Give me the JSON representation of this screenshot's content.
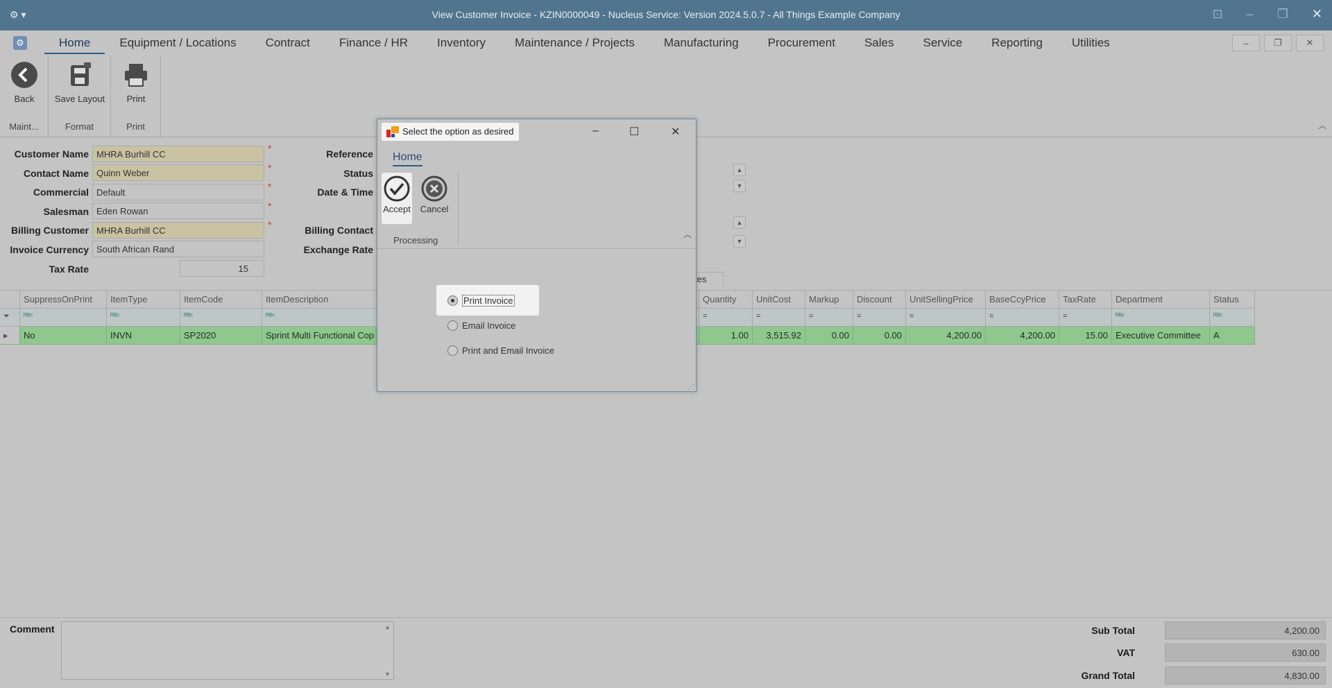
{
  "window": {
    "title": "View Customer Invoice - KZIN0000049 - Nucleus Service: Version 2024.5.0.7 - All Things Example Company"
  },
  "menu": {
    "tabs": [
      "Home",
      "Equipment / Locations",
      "Contract",
      "Finance / HR",
      "Inventory",
      "Maintenance / Projects",
      "Manufacturing",
      "Procurement",
      "Sales",
      "Service",
      "Reporting",
      "Utilities"
    ]
  },
  "ribbon": {
    "back_label": "Back",
    "save_layout_label": "Save Layout",
    "print_label": "Print",
    "group_maint": "Maint...",
    "group_format": "Format",
    "group_print": "Print"
  },
  "form": {
    "customer_name_label": "Customer Name",
    "customer_name_value": "MHRA Burhill CC",
    "contact_name_label": "Contact Name",
    "contact_name_value": "Quinn Weber",
    "commercial_label": "Commercial",
    "commercial_value": "Default",
    "salesman_label": "Salesman",
    "salesman_value": "Eden Rowan",
    "billing_customer_label": "Billing Customer",
    "billing_customer_value": "MHRA Burhill CC",
    "invoice_currency_label": "Invoice Currency",
    "invoice_currency_value": "South African Rand",
    "tax_rate_label": "Tax Rate",
    "tax_rate_value": "15",
    "reference_label": "Reference",
    "status_label": "Status",
    "date_time_label": "Date & Time",
    "billing_contact_label": "Billing Contact",
    "exchange_rate_label": "Exchange Rate",
    "required_mark": "*"
  },
  "grid": {
    "tab_fragment": "tes",
    "columns": [
      "SuppressOnPrint",
      "ItemType",
      "ItemCode",
      "ItemDescription",
      "Quantity",
      "UnitCost",
      "Markup",
      "Discount",
      "UnitSellingPrice",
      "BaseCcyPrice",
      "TaxRate",
      "Department",
      "Status"
    ],
    "filter_text": "ᴿᴮᶜ",
    "filter_eq": "=",
    "rows": [
      [
        "No",
        "INVN",
        "SP2020",
        "Sprint Multi Functional Cop",
        "1.00",
        "3,515.92",
        "0.00",
        "0.00",
        "4,200.00",
        "4,200.00",
        "15.00",
        "Executive Committee",
        "A"
      ]
    ]
  },
  "footer": {
    "comment_label": "Comment",
    "sub_total_label": "Sub Total",
    "sub_total_value": "4,200.00",
    "vat_label": "VAT",
    "vat_value": "630.00",
    "grand_total_label": "Grand Total",
    "grand_total_value": "4,830.00"
  },
  "dialog": {
    "title": "Select the option as desired",
    "tab": "Home",
    "accept_label": "Accept",
    "cancel_label": "Cancel",
    "group_label": "Processing",
    "options": [
      "Print Invoice",
      "Email Invoice",
      "Print and Email Invoice"
    ],
    "selected_option": "Print Invoice"
  }
}
